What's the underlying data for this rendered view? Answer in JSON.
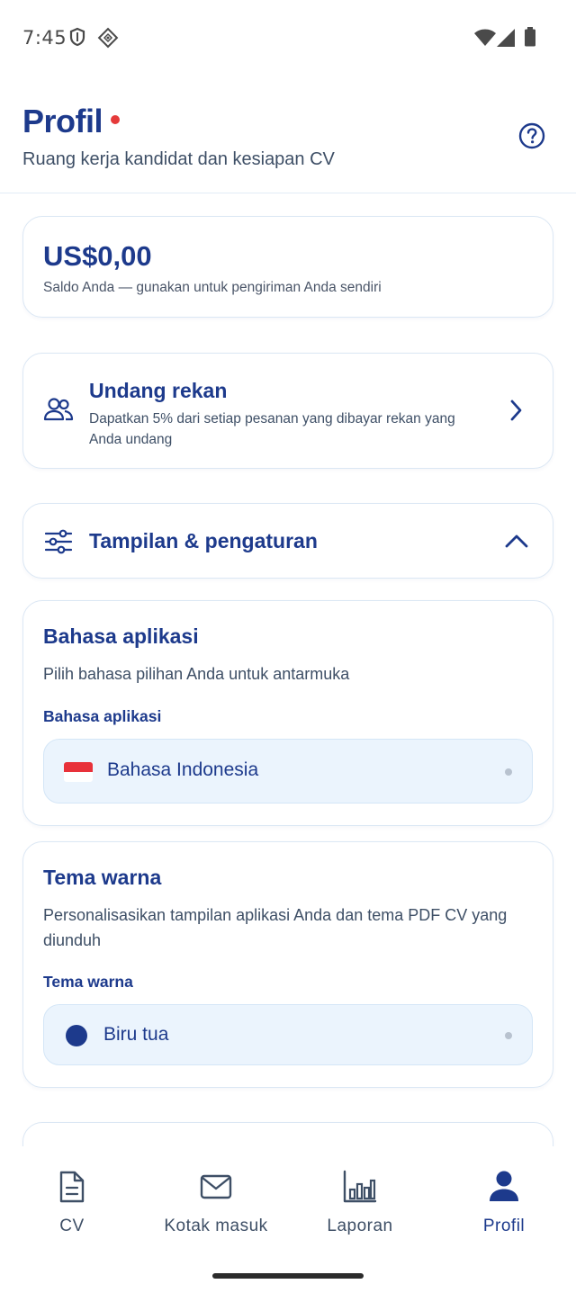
{
  "status_bar": {
    "time": "7:45",
    "left_icons": [
      "shield-icon",
      "diamond-grid-icon"
    ],
    "right_icons": [
      "wifi-icon",
      "cellular-signal-icon",
      "battery-icon"
    ]
  },
  "header": {
    "title": "Profil",
    "subtitle": "Ruang kerja kandidat dan kesiapan CV",
    "help_icon": "help-circle-icon",
    "notification_dot_color": "#e53a3a"
  },
  "balance": {
    "amount": "US$0,00",
    "description": "Saldo Anda — gunakan untuk pengiriman Anda sendiri"
  },
  "invite": {
    "icon": "users-icon",
    "title": "Undang rekan",
    "description": "Dapatkan 5% dari setiap pesanan yang dibayar rekan yang Anda undang"
  },
  "settings": {
    "icon": "sliders-icon",
    "title": "Tampilan & pengaturan",
    "expanded": true
  },
  "language": {
    "title": "Bahasa aplikasi",
    "description": "Pilih bahasa pilihan Anda untuk antarmuka",
    "field_label": "Bahasa aplikasi",
    "selected": "Bahasa Indonesia",
    "flag": "indonesia-flag-icon"
  },
  "theme": {
    "title": "Tema warna",
    "description": "Personalisasikan tampilan aplikasi Anda dan tema PDF CV yang diunduh",
    "field_label": "Tema warna",
    "selected": "Biru tua",
    "swatch_color": "#1d3a8c"
  },
  "bottom_nav": {
    "items": [
      {
        "label": "CV",
        "icon": "document-icon",
        "active": false
      },
      {
        "label": "Kotak masuk",
        "icon": "mail-icon",
        "active": false
      },
      {
        "label": "Laporan",
        "icon": "bar-chart-icon",
        "active": false
      },
      {
        "label": "Profil",
        "icon": "person-icon",
        "active": true
      }
    ]
  },
  "colors": {
    "primary": "#1d3a8c",
    "card_border": "#dbe7f4",
    "select_background": "#ebf4fd",
    "text_secondary": "#3e4f66"
  }
}
